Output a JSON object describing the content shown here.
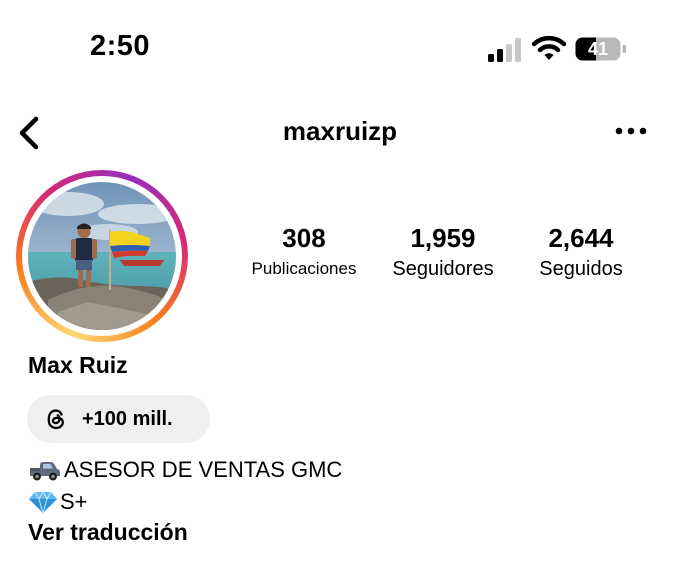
{
  "status_bar": {
    "time": "2:50",
    "battery_level": "41",
    "signal_icon": "cellular-signal-icon",
    "wifi_icon": "wifi-icon",
    "battery_icon": "battery-icon"
  },
  "nav": {
    "username": "maxruizp",
    "back_icon": "chevron-left-icon",
    "more_icon": "more-horizontal-icon"
  },
  "profile": {
    "display_name": "Max Ruiz",
    "story_ring_colors": [
      "#feda75",
      "#fa7e1e",
      "#d62976",
      "#962fbf"
    ],
    "stats": [
      {
        "value": "308",
        "label": "Publicaciones"
      },
      {
        "value": "1,959",
        "label": "Seguidores"
      },
      {
        "value": "2,644",
        "label": "Seguidos"
      }
    ],
    "threads": {
      "icon": "threads-icon",
      "count": "+100 mill."
    },
    "bio": [
      {
        "emoji": "pickup-truck-icon",
        "text": "ASESOR DE VENTAS GMC"
      },
      {
        "emoji": "gem-icon",
        "text": "S+"
      }
    ],
    "translate_link": "Ver traducción"
  }
}
